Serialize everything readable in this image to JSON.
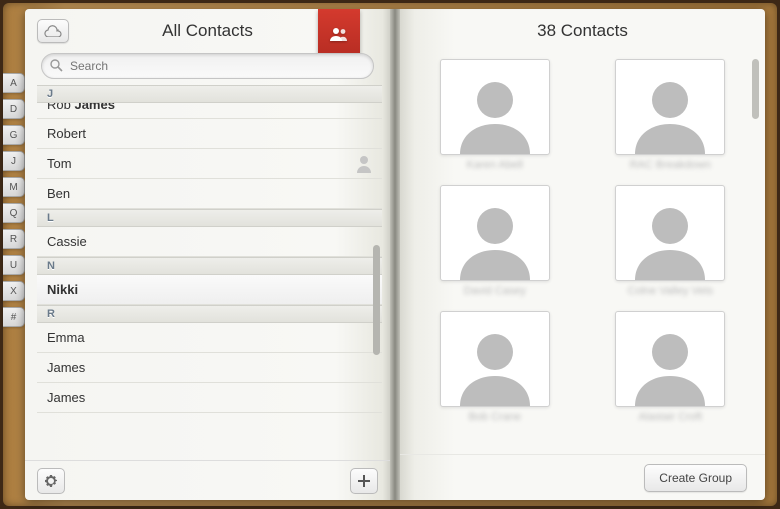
{
  "header": {
    "left_title": "All Contacts",
    "right_title": "38 Contacts"
  },
  "search": {
    "placeholder": "Search",
    "value": ""
  },
  "letter_tabs": [
    "A",
    "D",
    "G",
    "J",
    "M",
    "Q",
    "R",
    "U",
    "X",
    "#"
  ],
  "contact_list": [
    {
      "type": "section",
      "letter": "J"
    },
    {
      "type": "contact",
      "first": "Rob",
      "last": "James",
      "cut": true
    },
    {
      "type": "contact",
      "first": "Robert",
      "last": ""
    },
    {
      "type": "contact",
      "first": "Tom",
      "last": "",
      "me": true
    },
    {
      "type": "contact",
      "first": "Ben",
      "last": ""
    },
    {
      "type": "section",
      "letter": "L"
    },
    {
      "type": "contact",
      "first": "Cassie",
      "last": ""
    },
    {
      "type": "section",
      "letter": "N"
    },
    {
      "type": "contact",
      "first": "Nikki",
      "last": "",
      "selected": true
    },
    {
      "type": "section",
      "letter": "R"
    },
    {
      "type": "contact",
      "first": "Emma",
      "last": ""
    },
    {
      "type": "contact",
      "first": "James",
      "last": ""
    },
    {
      "type": "contact",
      "first": "James",
      "last": ""
    }
  ],
  "grid_contacts": [
    {
      "name": "Karen Abell"
    },
    {
      "name": "RAC Breakdown"
    },
    {
      "name": "David Casey"
    },
    {
      "name": "Colne Valley Vets"
    },
    {
      "name": "Bob Crane"
    },
    {
      "name": "Alastair Croft"
    }
  ],
  "buttons": {
    "create_group": "Create Group"
  },
  "icons": {
    "cloud": "cloud-icon",
    "ribbon": "group-icon",
    "gear": "gear-icon",
    "add": "add-icon",
    "me": "person-icon",
    "search": "search-icon"
  }
}
